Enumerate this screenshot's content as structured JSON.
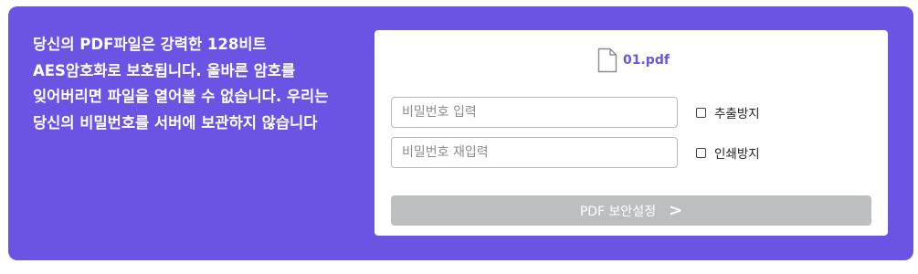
{
  "description": "당신의 PDF파일은 강력한 128비트 AES암호화로 보호됩니다. 올바른 암호를 잊어버리면 파일을 열어볼 수 없습니다. 우리는 당신의 비밀번호를 서버에 보관하지 않습니다",
  "file": {
    "name": "01.pdf",
    "icon": "file-icon"
  },
  "password": {
    "placeholder": "비밀번호 입력",
    "value": ""
  },
  "password_confirm": {
    "placeholder": "비밀번호 재입력",
    "value": ""
  },
  "options": {
    "prevent_extract": {
      "label": "추출방지",
      "checked": false
    },
    "prevent_print": {
      "label": "인쇄방지",
      "checked": false
    }
  },
  "submit": {
    "label": "PDF 보안설정",
    "arrow": ">",
    "enabled": false
  },
  "colors": {
    "accent": "#6b53e3",
    "button_disabled": "#bdbec0",
    "card": "#ffffff"
  }
}
